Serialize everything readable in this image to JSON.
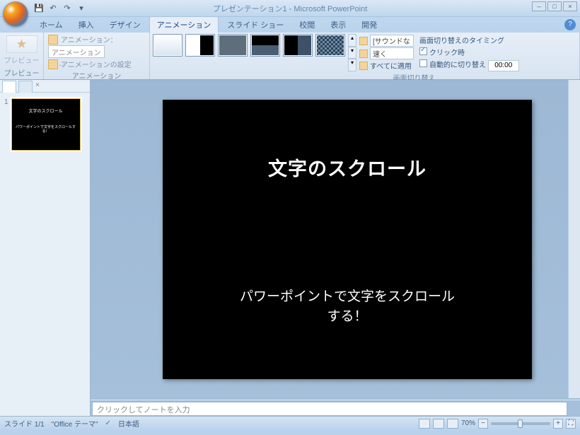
{
  "app": {
    "title": "プレゼンテーション1 - Microsoft PowerPoint"
  },
  "qat": {
    "save": "save-icon",
    "undo": "↶",
    "redo": "↷",
    "more": "▾"
  },
  "tabs": {
    "home": "ホーム",
    "insert": "挿入",
    "design": "デザイン",
    "animation": "アニメーション",
    "slideshow": "スライド ショー",
    "review": "校閲",
    "view": "表示",
    "developer": "開発"
  },
  "ribbon": {
    "preview": {
      "label": "プレビュー",
      "btn": "プレビュー"
    },
    "anim": {
      "row1": "アニメーション：",
      "dd1": "アニメーションし…",
      "row2": "アニメーションの設定",
      "label": "アニメーション"
    },
    "transition": {
      "sound_label": "[サウンドなし]",
      "speed_label": "速く",
      "applyall": "すべてに適用",
      "label": "画面切り替え"
    },
    "timing": {
      "header": "画面切り替えのタイミング",
      "onclick": "クリック時",
      "auto": "自動的に切り替え",
      "time": "00:00"
    }
  },
  "thumb": {
    "num": "1",
    "title": "文字のスクロール",
    "body": "パワーポイントで文字をスクロールする！"
  },
  "slide": {
    "title": "文字のスクロール",
    "body1": "パワーポイントで文字をスクロール",
    "body2": "する！"
  },
  "notes": {
    "placeholder": "クリックしてノートを入力"
  },
  "status": {
    "slide": "スライド 1/1",
    "theme": "\"Office テーマ\"",
    "lang": "日本語",
    "zoom": "70%"
  }
}
